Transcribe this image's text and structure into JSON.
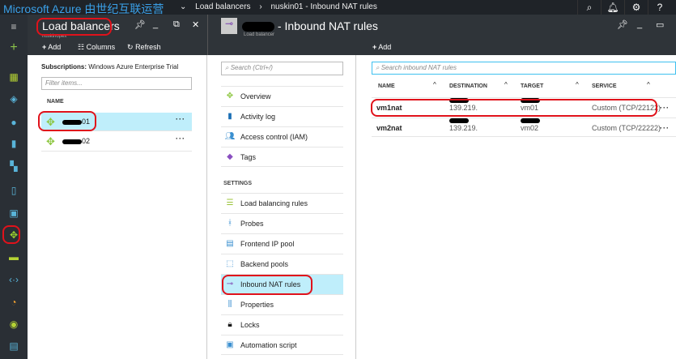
{
  "topbar": {
    "brand": "Microsoft Azure 由世纪互联运营",
    "crumbs": [
      "Load balancers",
      "nuskin01 - Inbound NAT rules"
    ]
  },
  "blade1": {
    "title": "Load balancers",
    "subtitle": "nuskinopex",
    "add": "Add",
    "columns": "Columns",
    "refresh": "Refresh",
    "subscriptions_label": "Subscriptions:",
    "subscriptions_value": "Windows Azure Enterprise Trial",
    "filter_placeholder": "Filter items...",
    "name_header": "NAME",
    "items": [
      {
        "suffix": "01"
      },
      {
        "suffix": "02"
      }
    ]
  },
  "blade2": {
    "title": "- Inbound NAT rules",
    "subtitle": "Load balancer",
    "search_placeholder": "Search (Ctrl+/)",
    "menu": [
      "Overview",
      "Activity log",
      "Access control (IAM)",
      "Tags"
    ],
    "settings_label": "SETTINGS",
    "settings": [
      "Load balancing rules",
      "Probes",
      "Frontend IP pool",
      "Backend pools",
      "Inbound NAT rules",
      "Properties",
      "Locks",
      "Automation script"
    ],
    "add": "Add",
    "rules_search_placeholder": "Search inbound NAT rules",
    "columns": [
      "NAME",
      "DESTINATION",
      "TARGET",
      "SERVICE"
    ],
    "rows": [
      {
        "name": "vm1nat",
        "destination": "139.219.",
        "target": "vm01",
        "service": "Custom (TCP/22122)"
      },
      {
        "name": "vm2nat",
        "destination": "139.219.",
        "target": "vm02",
        "service": "Custom (TCP/22222)"
      }
    ]
  },
  "colors": {
    "accent": "#3aa0e8",
    "selected": "#bfeefb",
    "annotation": "#e0121b"
  }
}
